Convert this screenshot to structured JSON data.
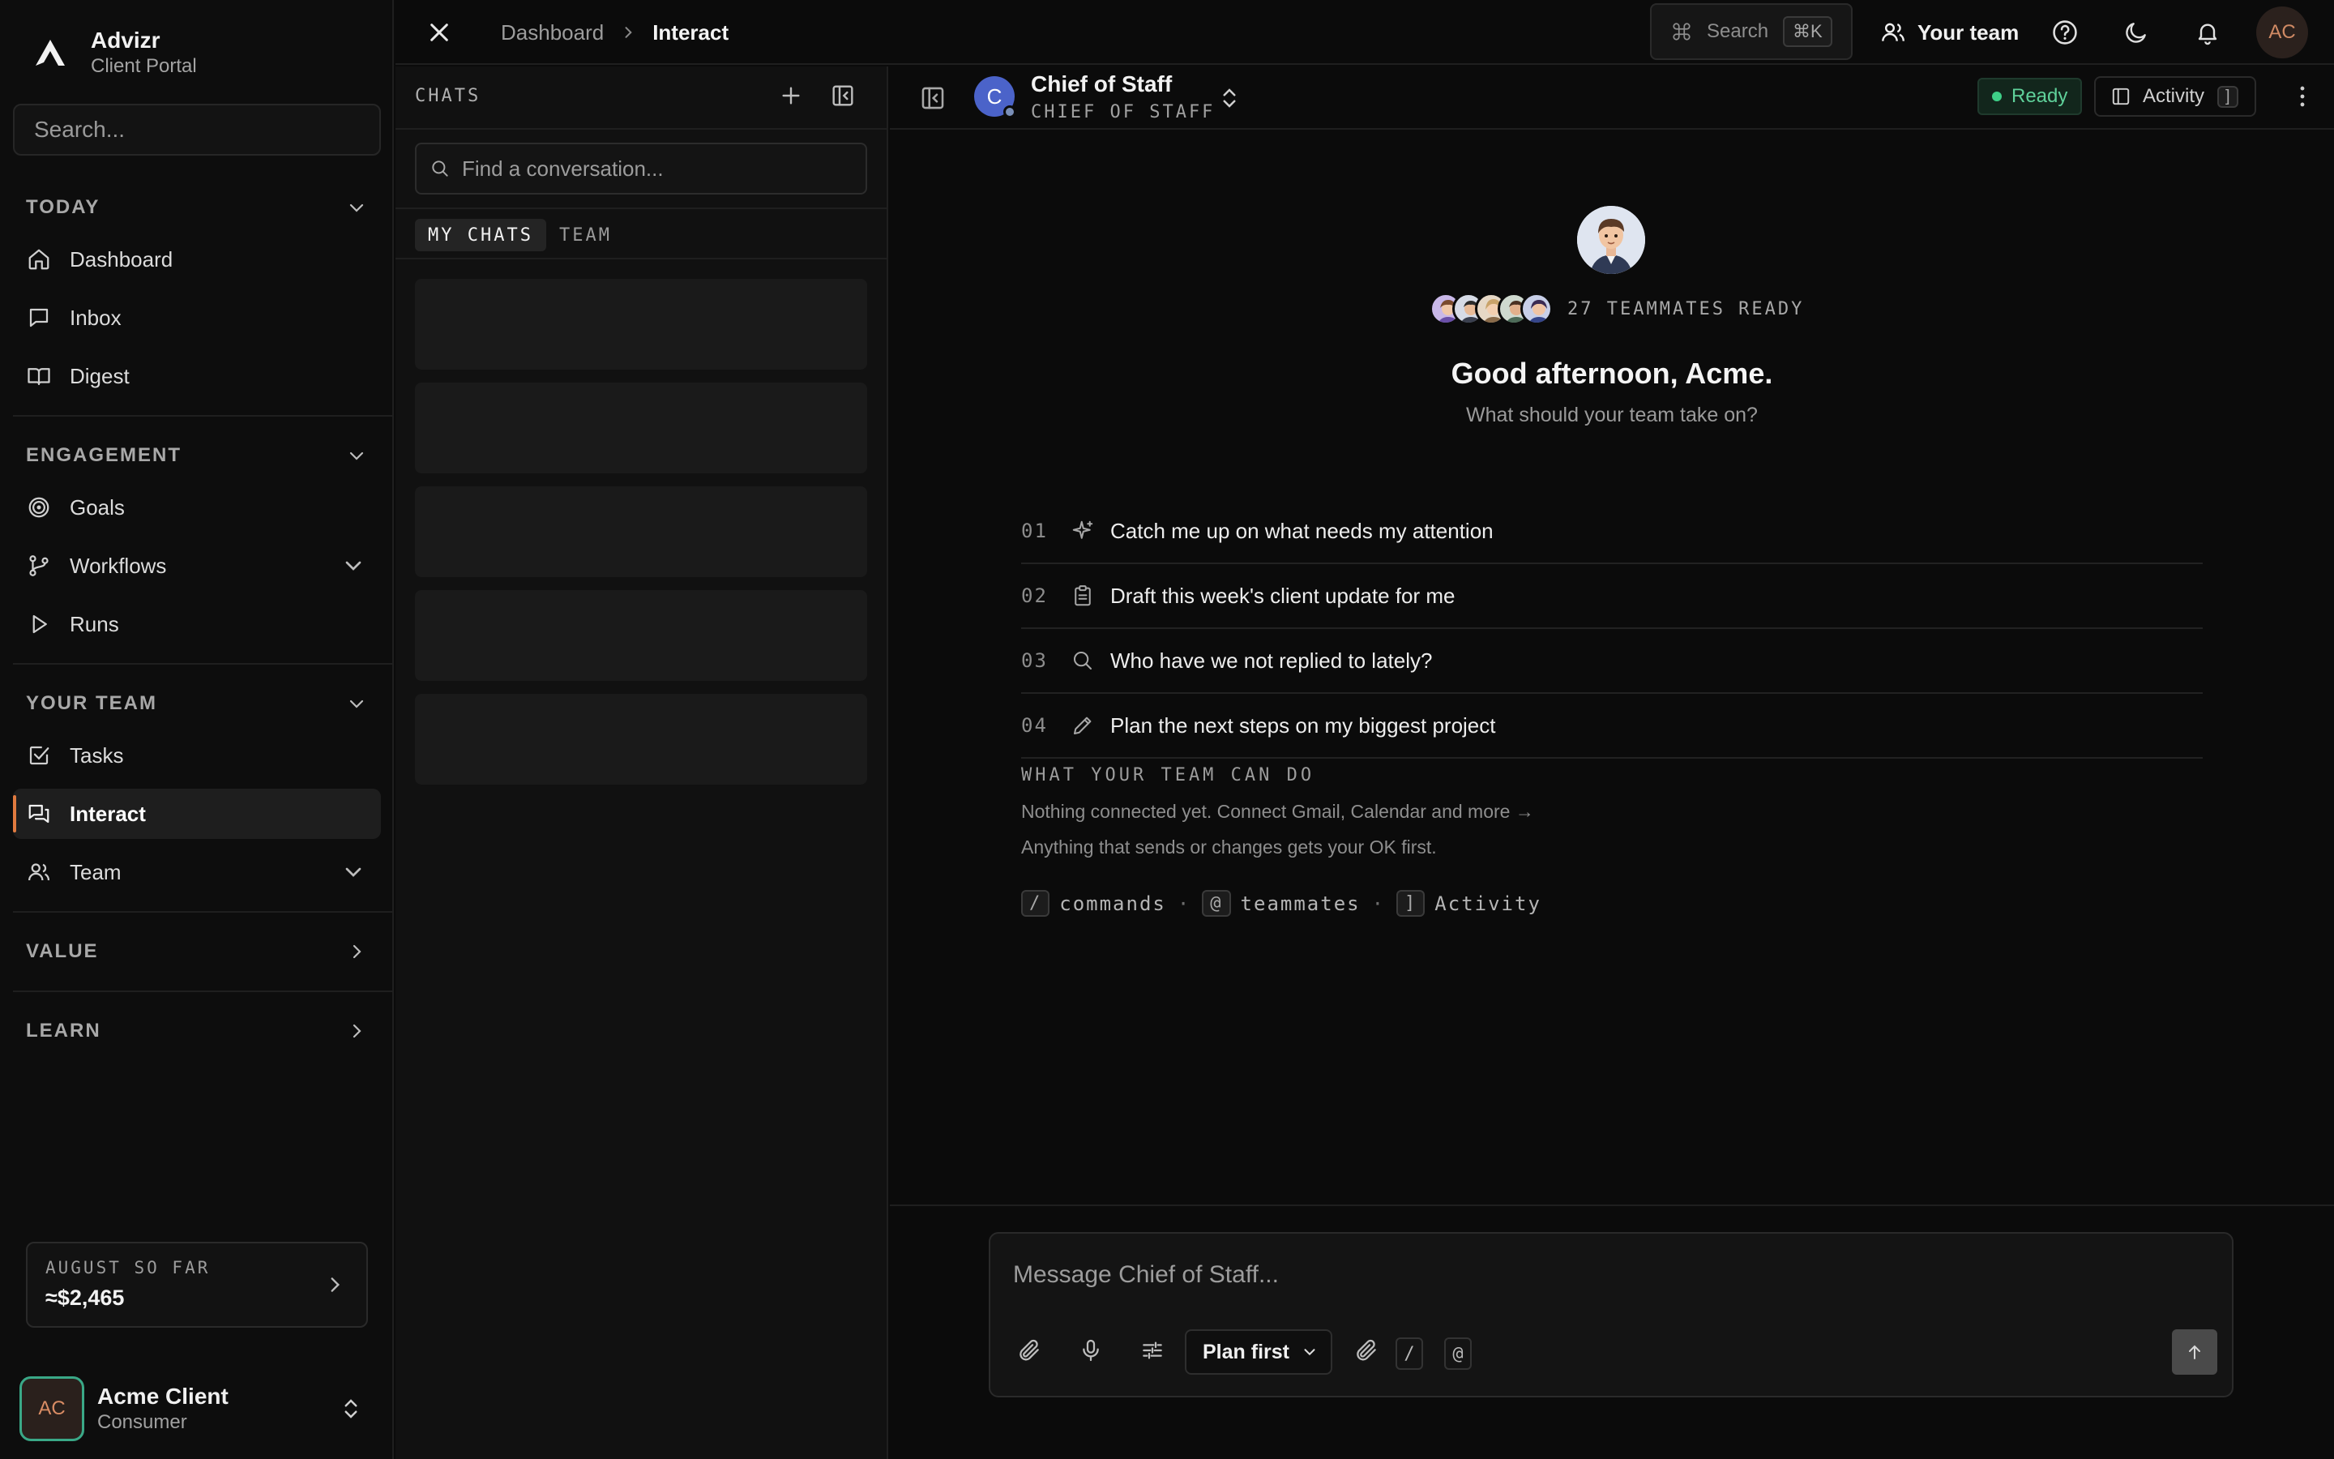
{
  "brand": {
    "name": "Advizr",
    "subtitle": "Client Portal"
  },
  "sidebar": {
    "search_placeholder": "Search...",
    "sections": {
      "today": "TODAY",
      "engagement": "ENGAGEMENT",
      "your_team": "YOUR TEAM",
      "value": "VALUE",
      "learn": "LEARN"
    },
    "items": {
      "dashboard": "Dashboard",
      "inbox": "Inbox",
      "digest": "Digest",
      "goals": "Goals",
      "workflows": "Workflows",
      "runs": "Runs",
      "tasks": "Tasks",
      "interact": "Interact",
      "team": "Team"
    },
    "active_item": "interact",
    "month_card": {
      "label": "AUGUST SO FAR",
      "value": "≈$2,465"
    },
    "user": {
      "initials": "AC",
      "name": "Acme Client",
      "role": "Consumer"
    }
  },
  "topbar": {
    "breadcrumb": [
      "Dashboard",
      "Interact"
    ],
    "search_label": "Search",
    "search_shortcut": "⌘K",
    "team_button": "Your team",
    "avatar_initials": "AC"
  },
  "chats": {
    "title": "CHATS",
    "find_placeholder": "Find a conversation...",
    "tabs": {
      "mine": "MY CHATS",
      "team": "TEAM"
    },
    "active_tab": "mine",
    "loading_rows": 5
  },
  "agent": {
    "initial": "C",
    "name": "Chief of Staff",
    "role": "CHIEF OF STAFF",
    "status": "Ready",
    "activity_label": "Activity",
    "activity_shortcut": "]"
  },
  "welcome": {
    "teammates_ready": "27 TEAMMATES READY",
    "greeting": "Good afternoon, Acme.",
    "subtitle": "What should your team take on?",
    "suggestions": [
      {
        "num": "01",
        "icon": "sparkle-icon",
        "text": "Catch me up on what needs my attention"
      },
      {
        "num": "02",
        "icon": "clipboard-icon",
        "text": "Draft this week's client update for me"
      },
      {
        "num": "03",
        "icon": "search-icon",
        "text": "Who have we not replied to lately?"
      },
      {
        "num": "04",
        "icon": "pencil-icon",
        "text": "Plan the next steps on my biggest project"
      }
    ],
    "capabilities_title": "WHAT YOUR TEAM CAN DO",
    "capabilities_line1": "Nothing connected yet. Connect Gmail, Calendar and more →",
    "capabilities_line2": "Anything that sends or changes gets your OK first.",
    "hints": {
      "commands_key": "/",
      "commands": "commands",
      "teammates_key": "@",
      "teammates": "teammates",
      "activity_key": "]",
      "activity": "Activity",
      "separator": "·"
    }
  },
  "composer": {
    "placeholder": "Message Chief of Staff...",
    "mode": "Plan first",
    "slash_key": "/",
    "mention_key": "@"
  },
  "colors": {
    "accent": "#e07a3f",
    "ready": "#3ecf87",
    "agent_avatar": "#4b63c9",
    "user_ring": "#3aa887"
  }
}
